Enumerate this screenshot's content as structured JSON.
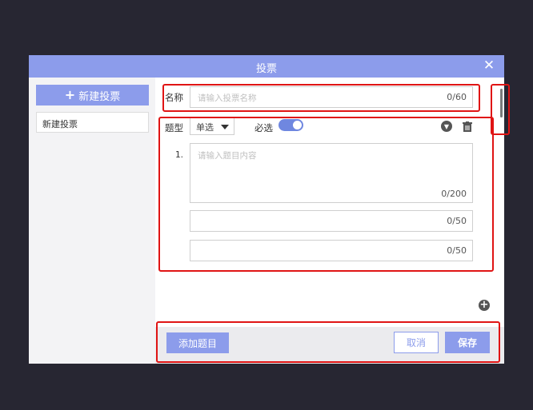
{
  "dialog": {
    "title": "投票",
    "close_icon": "close-icon"
  },
  "sidebar": {
    "new_button_label": "新建投票",
    "new_button_icon": "plus-icon",
    "items": [
      {
        "label": "新建投票"
      }
    ]
  },
  "form": {
    "name_label": "名称",
    "name_placeholder": "请输入投票名称",
    "name_counter": "0/60",
    "type_label": "题型",
    "type_value": "单选",
    "required_label": "必选",
    "required_on": true,
    "question_index": "1.",
    "question_placeholder": "请输入题目内容",
    "question_counter": "0/200",
    "options": [
      {
        "counter": "0/50"
      },
      {
        "counter": "0/50"
      }
    ]
  },
  "footer": {
    "add_question_label": "添加题目",
    "cancel_label": "取消",
    "save_label": "保存"
  },
  "colors": {
    "accent": "#8c9ceb",
    "toggle": "#6f87e0",
    "highlight": "#e01414",
    "backdrop": "#272632"
  }
}
